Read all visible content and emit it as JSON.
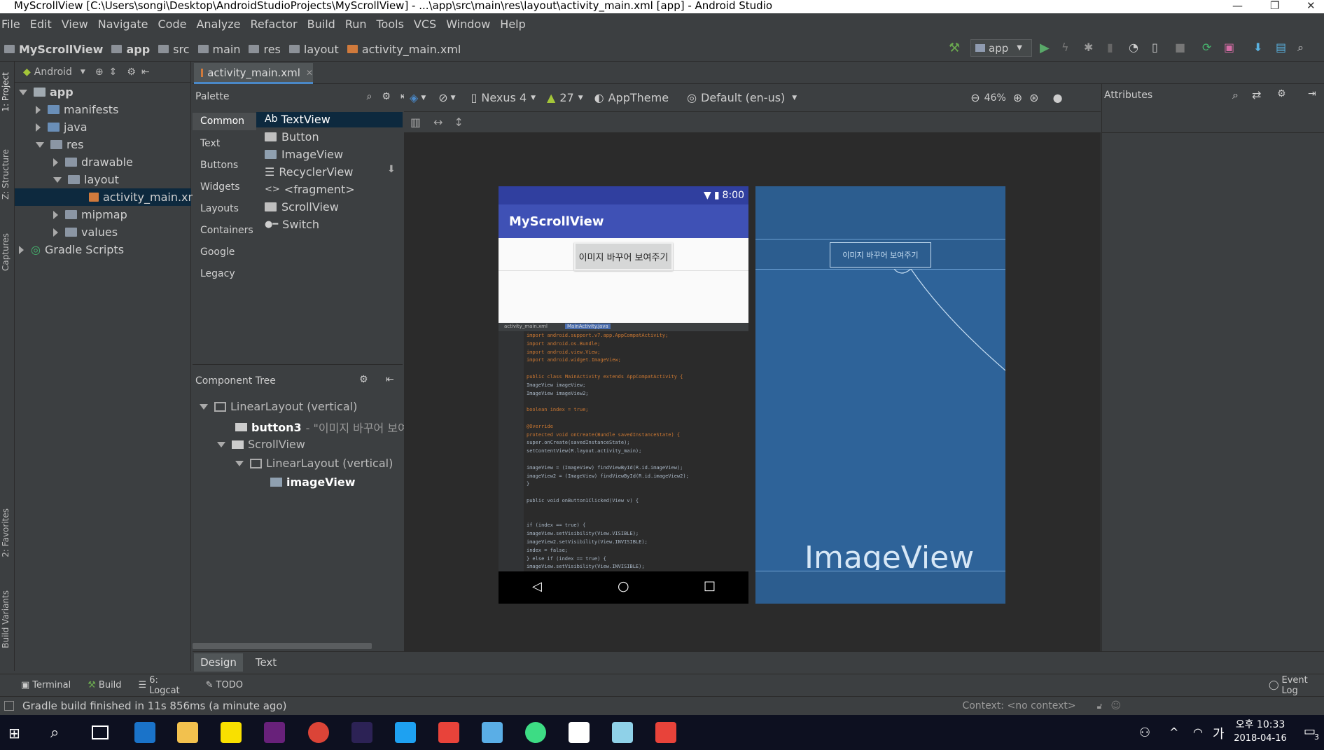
{
  "window": {
    "title": "MyScrollView [C:\\Users\\songi\\Desktop\\AndroidStudioProjects\\MyScrollView] - ...\\app\\src\\main\\res\\layout\\activity_main.xml [app] - Android Studio"
  },
  "menu": [
    "File",
    "Edit",
    "View",
    "Navigate",
    "Code",
    "Analyze",
    "Refactor",
    "Build",
    "Run",
    "Tools",
    "VCS",
    "Window",
    "Help"
  ],
  "breadcrumb": [
    "MyScrollView",
    "app",
    "src",
    "main",
    "res",
    "layout",
    "activity_main.xml"
  ],
  "toolbar": {
    "run_config": "app"
  },
  "project_panel": {
    "view_mode": "Android"
  },
  "tree": {
    "app": "app",
    "manifests": "manifests",
    "java": "java",
    "res": "res",
    "drawable": "drawable",
    "layout": "layout",
    "activity_main": "activity_main.xml",
    "mipmap": "mipmap",
    "values": "values",
    "gradle": "Gradle Scripts"
  },
  "left_tabs": [
    "1: Project",
    "Z: Structure",
    "Captures",
    "2: Favorites",
    "Build Variants"
  ],
  "editor_tab": "activity_main.xml",
  "palette": {
    "title": "Palette",
    "categories": [
      "Common",
      "Text",
      "Buttons",
      "Widgets",
      "Layouts",
      "Containers",
      "Google",
      "Legacy"
    ],
    "items": [
      "TextView",
      "Button",
      "ImageView",
      "RecyclerView",
      "<fragment>",
      "ScrollView",
      "Switch"
    ],
    "ab_label": "Ab"
  },
  "design_toolbar": {
    "device": "Nexus 4",
    "api": "27",
    "theme": "AppTheme",
    "locale": "Default (en-us)",
    "zoom": "46%"
  },
  "attributes_title": "Attributes",
  "component_tree": {
    "title": "Component Tree",
    "linear1": "LinearLayout (vertical)",
    "button_id": "button3",
    "button_text": "- \"이미지 바꾸어 보여주",
    "scroll": "ScrollView",
    "linear2": "LinearLayout (vertical)",
    "image": "imageView"
  },
  "phone": {
    "time": "8:00",
    "app_title": "MyScrollView",
    "button_label": "이미지 바꾸어 보여주기",
    "code_tab1": "activity_main.xml",
    "code_tab2": "MainActivity.java",
    "code_lines": [
      "import android.support.v7.app.AppCompatActivity;",
      "import android.os.Bundle;",
      "import android.view.View;",
      "import android.widget.ImageView;",
      "",
      "public class MainActivity extends AppCompatActivity {",
      "    ImageView imageView;",
      "    ImageView imageView2;",
      "",
      "    boolean index = true;",
      "",
      "    @Override",
      "    protected void onCreate(Bundle savedInstanceState) {",
      "        super.onCreate(savedInstanceState);",
      "        setContentView(R.layout.activity_main);",
      "",
      "        imageView = (ImageView) findViewById(R.id.imageView);",
      "        imageView2 = (ImageView) findViewById(R.id.imageView2);",
      "    }",
      "",
      "    public void onButton1Clicked(View v) {",
      "",
      "",
      "        if (index == true) {",
      "            imageView.setVisibility(View.VISIBLE);",
      "            imageView2.setVisibility(View.INVISIBLE);",
      "            index = false;",
      "        } else if (index == true) {",
      "            imageView.setVisibility(View.INVISIBLE);"
    ]
  },
  "blueprint": {
    "button_label": "이미지 바꾸어 보여주기",
    "image_label": "ImageView"
  },
  "bottom_tabs": [
    "Design",
    "Text"
  ],
  "tool_windows": [
    "Terminal",
    "Build",
    "6: Logcat",
    "TODO"
  ],
  "event_log": "Event Log",
  "status": {
    "message": "Gradle build finished in 11s 856ms (a minute ago)",
    "context": "Context: <no context>"
  },
  "clock": {
    "time": "오후 10:33",
    "date": "2018-04-16"
  },
  "tray": {
    "ime": "가",
    "notifications": "3"
  }
}
